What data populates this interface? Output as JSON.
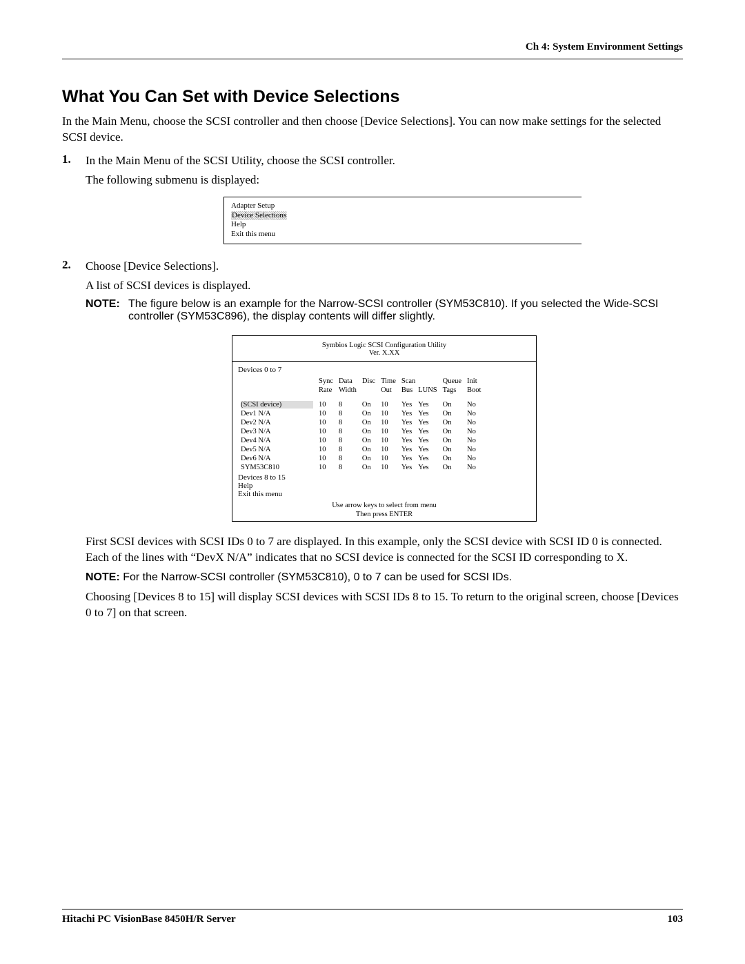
{
  "header": {
    "right": "Ch 4: System Environment Settings"
  },
  "title": "What You Can Set with Device Selections",
  "intro": "In the Main Menu, choose the SCSI controller and then choose [Device Selections]. You can now make settings for the selected SCSI device.",
  "steps": [
    {
      "num": "1.",
      "line1": "In the Main Menu of the SCSI Utility, choose the SCSI controller.",
      "line2": "The following submenu is displayed:"
    },
    {
      "num": "2.",
      "line1": "Choose [Device Selections].",
      "line2": "A list of SCSI devices is displayed."
    }
  ],
  "submenu": {
    "items": [
      "Adapter Setup",
      "Device Selections",
      "Help",
      "Exit this menu"
    ]
  },
  "note1_label": "NOTE:",
  "note1_body": "The figure below is an example for the Narrow-SCSI controller (SYM53C810). If you selected the Wide-SCSI controller (SYM53C896), the display contents will differ slightly.",
  "scsi": {
    "title1": "Symbios Logic SCSI Configuration Utility",
    "title2": "Ver. X.XX",
    "group": "Devices 0 to 7",
    "headers_top": [
      "",
      "Sync",
      "Data",
      "Disc",
      "Time",
      "Scan",
      "",
      "Queue",
      "Init"
    ],
    "headers_bot": [
      "",
      "Rate",
      "Width",
      "",
      "Out",
      "Bus",
      "LUNS",
      "Tags",
      "Boot"
    ],
    "rows": [
      {
        "name": "(SCSI device)",
        "sync": "10",
        "dw": "8",
        "disc": "On",
        "to": "10",
        "sb": "Yes",
        "sl": "Yes",
        "qt": "On",
        "ib": "No",
        "sel": true
      },
      {
        "name": "Dev1 N/A",
        "sync": "10",
        "dw": "8",
        "disc": "On",
        "to": "10",
        "sb": "Yes",
        "sl": "Yes",
        "qt": "On",
        "ib": "No"
      },
      {
        "name": "Dev2 N/A",
        "sync": "10",
        "dw": "8",
        "disc": "On",
        "to": "10",
        "sb": "Yes",
        "sl": "Yes",
        "qt": "On",
        "ib": "No"
      },
      {
        "name": "Dev3 N/A",
        "sync": "10",
        "dw": "8",
        "disc": "On",
        "to": "10",
        "sb": "Yes",
        "sl": "Yes",
        "qt": "On",
        "ib": "No"
      },
      {
        "name": "Dev4 N/A",
        "sync": "10",
        "dw": "8",
        "disc": "On",
        "to": "10",
        "sb": "Yes",
        "sl": "Yes",
        "qt": "On",
        "ib": "No"
      },
      {
        "name": "Dev5 N/A",
        "sync": "10",
        "dw": "8",
        "disc": "On",
        "to": "10",
        "sb": "Yes",
        "sl": "Yes",
        "qt": "On",
        "ib": "No"
      },
      {
        "name": "Dev6 N/A",
        "sync": "10",
        "dw": "8",
        "disc": "On",
        "to": "10",
        "sb": "Yes",
        "sl": "Yes",
        "qt": "On",
        "ib": "No"
      },
      {
        "name": "SYM53C810",
        "sync": "10",
        "dw": "8",
        "disc": "On",
        "to": "10",
        "sb": "Yes",
        "sl": "Yes",
        "qt": "On",
        "ib": "No"
      }
    ],
    "extra_items": [
      "Devices 8 to 15",
      "Help",
      "Exit this menu"
    ],
    "foot1": "Use arrow keys to select from menu",
    "foot2": "Then press ENTER"
  },
  "post_para": "First SCSI devices with SCSI IDs 0 to 7 are displayed. In this example, only the SCSI device with SCSI ID 0 is connected. Each of the lines with “DevX N/A” indicates that no SCSI device is connected for the SCSI ID corresponding to X.",
  "note2_label": "NOTE:",
  "note2_body": "For the Narrow-SCSI controller (SYM53C810), 0 to 7 can be used for SCSI IDs.",
  "post_para2": "Choosing [Devices 8 to 15] will display SCSI devices with SCSI IDs 8 to 15. To return to the original screen, choose [Devices 0 to 7] on that screen.",
  "footer": {
    "left": "Hitachi PC VisionBase 8450H/R Server",
    "right": "103"
  }
}
